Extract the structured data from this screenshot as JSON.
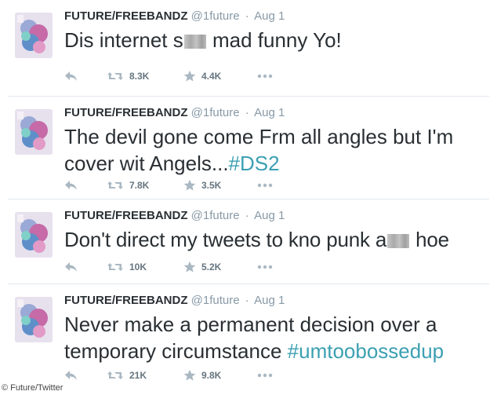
{
  "tweets": [
    {
      "name": "FUTURE/FREEBANDZ",
      "handle": "@1future",
      "separator": "·",
      "time": "Aug 1",
      "text_parts": [
        "Dis internet s",
        "mad funny Yo!"
      ],
      "retweets": "8.3K",
      "favorites": "4.4K"
    },
    {
      "name": "FUTURE/FREEBANDZ",
      "handle": "@1future",
      "separator": "·",
      "time": "Aug 1",
      "text_parts": [
        "The devil gone come Frm all angles but I'm cover wit Angels..."
      ],
      "hashtag": "#DS2",
      "retweets": "7.8K",
      "favorites": "3.5K"
    },
    {
      "name": "FUTURE/FREEBANDZ",
      "handle": "@1future",
      "separator": "·",
      "time": "Aug 1",
      "text_parts": [
        "Don't direct my tweets to kno punk a",
        "hoe"
      ],
      "retweets": "10K",
      "favorites": "5.2K"
    },
    {
      "name": "FUTURE/FREEBANDZ",
      "handle": "@1future",
      "separator": "·",
      "time": "Aug 1",
      "text_parts": [
        "Never make a permanent decision over a temporary circumstance "
      ],
      "hashtag": "#umtoobossedup",
      "retweets": "21K",
      "favorites": "9.8K"
    }
  ],
  "icons": {
    "reply": "reply-icon",
    "retweet": "retweet-icon",
    "favorite": "star-icon",
    "more": "more-icon"
  },
  "colors": {
    "text": "#292f33",
    "muted": "#8899a6",
    "hashtag": "#3ba0b2",
    "icon": "#aab8c2"
  },
  "credit": "© Future/Twitter"
}
